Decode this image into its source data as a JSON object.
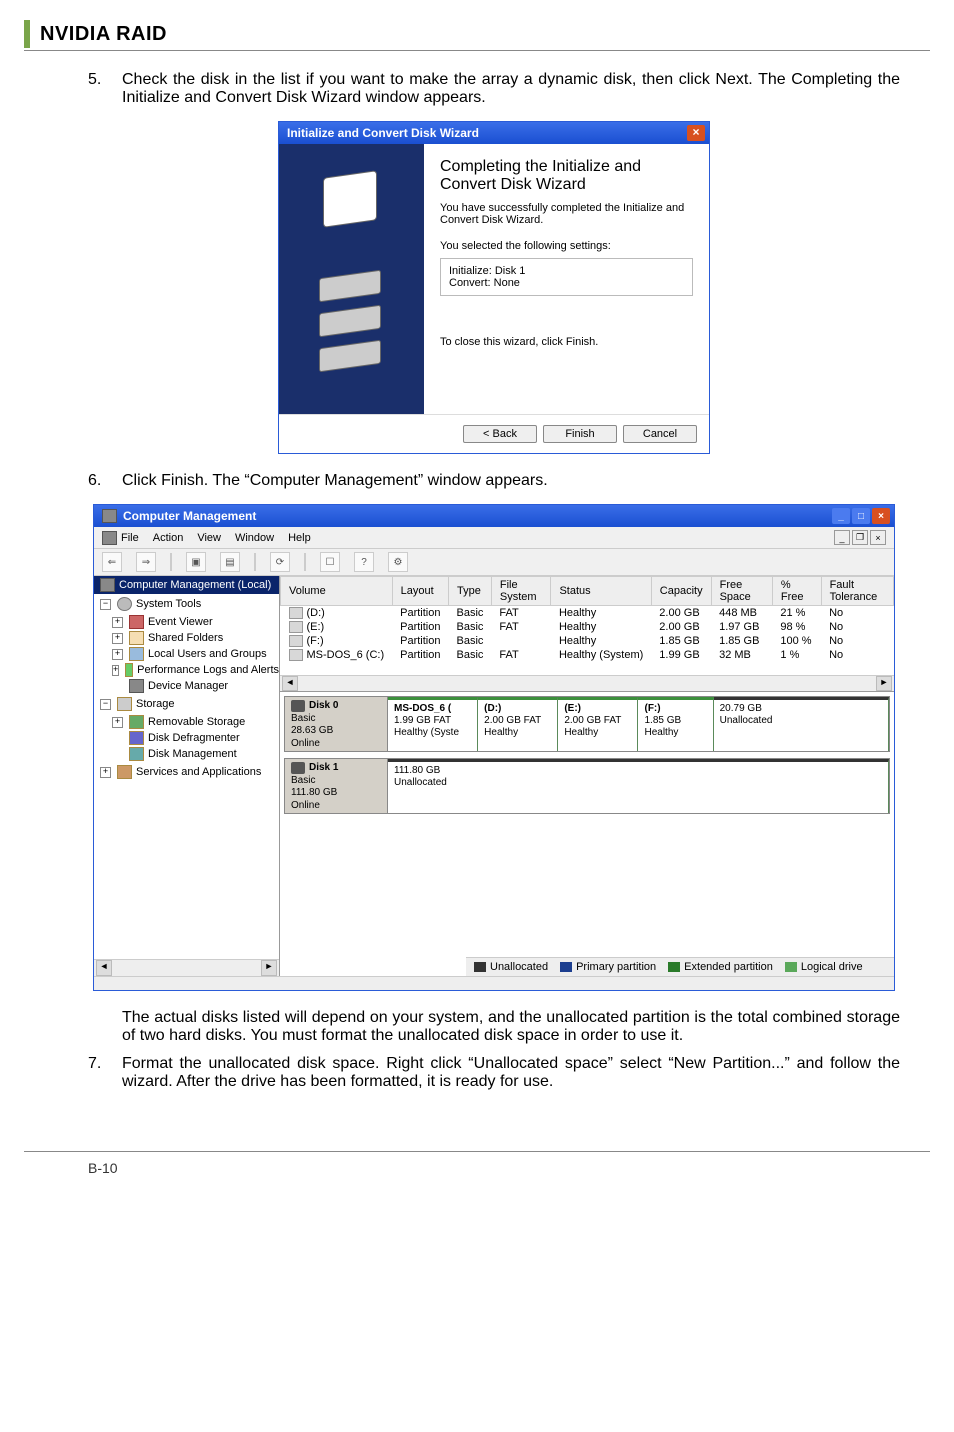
{
  "header": {
    "brand": "NVIDIA RAID"
  },
  "step5": {
    "num": "5.",
    "text": "Check the disk in the list if you want to make the array a dynamic disk, then click Next. The Completing the Initialize and Convert Disk Wizard window appears."
  },
  "wizard": {
    "title": "Initialize and Convert Disk Wizard",
    "heading": "Completing the Initialize and Convert Disk Wizard",
    "sub": "You have successfully completed the Initialize and Convert Disk Wizard.",
    "settings_label": "You selected the following settings:",
    "settings_box": "Initialize: Disk 1\nConvert: None",
    "close_hint": "To close this wizard, click Finish.",
    "buttons": {
      "back": "< Back",
      "finish": "Finish",
      "cancel": "Cancel"
    }
  },
  "step6": {
    "num": "6.",
    "text": "Click Finish. The “Computer Management” window appears."
  },
  "mgmt": {
    "title": "Computer Management",
    "menu": [
      "File",
      "Action",
      "View",
      "Window",
      "Help"
    ],
    "tree_root": "Computer Management (Local)",
    "tree": {
      "system_tools": "System Tools",
      "event_viewer": "Event Viewer",
      "shared_folders": "Shared Folders",
      "local_users": "Local Users and Groups",
      "perf_logs": "Performance Logs and Alerts",
      "device_mgr": "Device Manager",
      "storage": "Storage",
      "removable": "Removable Storage",
      "defrag": "Disk Defragmenter",
      "diskmgmt": "Disk Management",
      "services": "Services and Applications"
    },
    "columns": [
      "Volume",
      "Layout",
      "Type",
      "File System",
      "Status",
      "Capacity",
      "Free Space",
      "% Free",
      "Fault Tolerance"
    ],
    "volumes": [
      {
        "vol": "(D:)",
        "layout": "Partition",
        "type": "Basic",
        "fs": "FAT",
        "status": "Healthy",
        "cap": "2.00 GB",
        "free": "448 MB",
        "pct": "21 %",
        "ft": "No"
      },
      {
        "vol": "(E:)",
        "layout": "Partition",
        "type": "Basic",
        "fs": "FAT",
        "status": "Healthy",
        "cap": "2.00 GB",
        "free": "1.97 GB",
        "pct": "98 %",
        "ft": "No"
      },
      {
        "vol": "(F:)",
        "layout": "Partition",
        "type": "Basic",
        "fs": "",
        "status": "Healthy",
        "cap": "1.85 GB",
        "free": "1.85 GB",
        "pct": "100 %",
        "ft": "No"
      },
      {
        "vol": "MS-DOS_6 (C:)",
        "layout": "Partition",
        "type": "Basic",
        "fs": "FAT",
        "status": "Healthy (System)",
        "cap": "1.99 GB",
        "free": "32 MB",
        "pct": "1 %",
        "ft": "No"
      }
    ],
    "disk0": {
      "name": "Disk 0",
      "kind": "Basic",
      "size": "28.63 GB",
      "state": "Online",
      "parts": [
        {
          "title": "MS-DOS_6 (",
          "size": "1.99 GB FAT",
          "st": "Healthy (Syste",
          "w": 18
        },
        {
          "title": "(D:)",
          "size": "2.00 GB FAT",
          "st": "Healthy",
          "w": 16
        },
        {
          "title": "(E:)",
          "size": "2.00 GB FAT",
          "st": "Healthy",
          "w": 16
        },
        {
          "title": "(F:)",
          "size": "1.85 GB",
          "st": "Healthy",
          "w": 15
        },
        {
          "title": "",
          "size": "20.79 GB",
          "st": "Unallocated",
          "w": 35,
          "unalloc": true
        }
      ]
    },
    "disk1": {
      "name": "Disk 1",
      "kind": "Basic",
      "size": "111.80 GB",
      "state": "Online",
      "parts": [
        {
          "title": "",
          "size": "111.80 GB",
          "st": "Unallocated",
          "w": 100,
          "unalloc": true
        }
      ]
    },
    "legend": {
      "unalloc": "Unallocated",
      "primary": "Primary partition",
      "extended": "Extended partition",
      "logical": "Logical drive"
    }
  },
  "para_after_mgmt": "The actual disks listed will depend on your system, and the unallocated partition is the total combined storage of two hard disks. You must format the unallocated disk space in order to use it.",
  "step7": {
    "num": "7.",
    "text": "Format the unallocated disk space. Right click “Unallocated space” select “New Partition...” and follow the wizard. After the drive has been formatted, it is ready for use."
  },
  "page_number": "B-10"
}
